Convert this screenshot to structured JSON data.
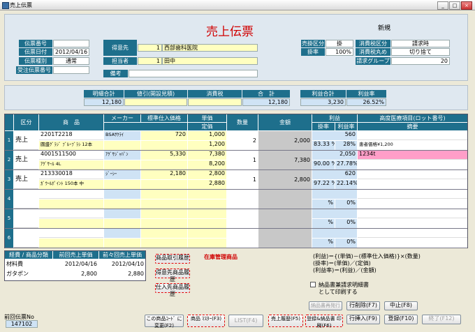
{
  "window": {
    "title": "売上伝票",
    "min": "_",
    "max": "□",
    "close": "×"
  },
  "header": {
    "title": "売上伝票",
    "mode": "新規"
  },
  "left": {
    "denpyo_no_label": "伝票番号",
    "denpyo_no": "",
    "date_label": "伝票日付",
    "date": "2012/04/16",
    "type_label": "伝票種別",
    "type": "通常",
    "order_label": "受注伝票番号",
    "order": ""
  },
  "customer": {
    "tokui_label": "得意先",
    "tokui_code": "1",
    "tokui_name": "西部歯科医院",
    "tanto_label": "担当者",
    "tanto_code": "1",
    "tanto_name": "田中",
    "biko_label": "備考",
    "biko": ""
  },
  "tax": {
    "kubun_label": "売掛区分",
    "kubun": "掛",
    "calc_label": "消費税区分",
    "calc": "請求時",
    "rate_label": "掛率",
    "rate": "100%",
    "round_label": "消費税丸め",
    "round": "切り捨て",
    "group_label": "請求グループ",
    "group": "20"
  },
  "totals": {
    "meisai_label": "明細合計",
    "meisai": "12,180",
    "nebiki_label": "値引(開設見積)",
    "nebiki": "",
    "shohizei_label": "消費税",
    "shohizei": "",
    "gokei_label": "合　計",
    "gokei": "12,180",
    "rieki_label": "利益合計",
    "rieki": "3,230",
    "riekiritsu_label": "利益率",
    "riekiritsu": "26.52%"
  },
  "grid": {
    "h_kubun": "区分",
    "h_shohin": "商　品",
    "h_maker": "メーカー",
    "h_hyojun": "標準仕入価格",
    "h_tanka": "単価",
    "h_teika": "定価",
    "h_suryo": "数量",
    "h_kingaku": "金額",
    "h_rieki": "利益",
    "h_kakeritsu": "掛率",
    "h_riekiritsu": "利益率",
    "h_kodo": "高度医療項目(ロット番号)",
    "h_tekiyo": "摘要",
    "rows": [
      {
        "no": "1",
        "kubun": "売上",
        "code": "2201T2218",
        "name": "圓盛ｸﾞﾗｼﾞ ﾌﾞﾙｰﾌﾞﾗｼ 12本",
        "maker": "BSAｻｸﾗｲ",
        "hyojun": "720",
        "tanka": "1,000",
        "teika": "1,200",
        "suryo": "2",
        "kingaku": "2,000",
        "rieki": "560",
        "kakeritsu": "83.33 %",
        "riekiritsu": "28%",
        "lot": "",
        "tekiyo": "患者価格¥1,200"
      },
      {
        "no": "2",
        "kubun": "売上",
        "code": "4001511500",
        "name": "ｱｸﾞｻｰﾙ 4L",
        "maker": "ｱｸﾞｻｼﾞｬﾊﾟﾝ",
        "hyojun": "5,330",
        "tanka": "7,380",
        "teika": "8,200",
        "suryo": "1",
        "kingaku": "7,380",
        "rieki": "2,050",
        "kakeritsu": "90.00 %",
        "riekiritsu": "27.78%",
        "lot": "1234t",
        "tekiyo": ""
      },
      {
        "no": "3",
        "kubun": "売上",
        "code": "213330018",
        "name": "ｶﾞｳｰﾙﾎﾟｲﾝﾄ 150本 中",
        "maker": "ｼﾞｰｼｰ",
        "hyojun": "2,180",
        "tanka": "2,800",
        "teika": "2,880",
        "suryo": "1",
        "kingaku": "2,800",
        "rieki": "620",
        "kakeritsu": "97.22 %",
        "riekiritsu": "22.14%",
        "lot": "",
        "tekiyo": ""
      },
      {
        "no": "4",
        "kubun": "",
        "code": "",
        "name": "",
        "maker": "",
        "hyojun": "",
        "tanka": "",
        "teika": "",
        "suryo": "",
        "kingaku": "",
        "rieki": "",
        "kakeritsu": "%",
        "riekiritsu": "0%",
        "lot": "",
        "tekiyo": ""
      },
      {
        "no": "5",
        "kubun": "",
        "code": "",
        "name": "",
        "maker": "",
        "hyojun": "",
        "tanka": "",
        "teika": "",
        "suryo": "",
        "kingaku": "",
        "rieki": "",
        "kakeritsu": "%",
        "riekiritsu": "0%",
        "lot": "",
        "tekiyo": ""
      },
      {
        "no": "6",
        "kubun": "",
        "code": "",
        "name": "",
        "maker": "",
        "hyojun": "",
        "tanka": "",
        "teika": "",
        "suryo": "",
        "kingaku": "",
        "rieki": "",
        "kakeritsu": "%",
        "riekiritsu": "0%",
        "lot": "",
        "tekiyo": ""
      }
    ]
  },
  "history": {
    "h_bunrui": "経費 / 商品分類",
    "h_prev": "前回売上単価",
    "h_prev2": "前々回売上単価",
    "rows": [
      {
        "bunrui": "材料費",
        "prev": "2012/04/16",
        "prev2": "2012/04/10"
      },
      {
        "bunrui": "ガタポン",
        "prev": "2,800",
        "prev2": "2,880"
      }
    ]
  },
  "midbuttons": {
    "b1": "商品取引履歴",
    "b2": "得意先商品履歴",
    "b3": "仕入先商品履歴"
  },
  "stock_label": "在庫管理商品",
  "formula": {
    "l1": "(利益)＝{(単価)－(標準仕入価格)}×(数量)",
    "l2": "(掛率)＝(単価)／(定価)",
    "l3": "(利益率)＝(利益)／(金額)"
  },
  "print_check": {
    "label1": "納品書兼請求明細書",
    "label2": "として印刷する"
  },
  "buttons": {
    "nohin": "納品書再発行",
    "row_delete": "行削除(F7)",
    "cancel": "中止(F8)",
    "row_insert": "行挿入(F9)",
    "register": "登録(F10)",
    "end": "終了(F12)",
    "code_change": "この商品ｺｰﾄﾞ に変更(F2)",
    "shohin_master": "商品 ﾏｽﾀｰ(F3)",
    "list": "LIST(F4)",
    "sales_history": "売上履歴(F5)",
    "register_print": "登録&納品書 印刷(F6)"
  },
  "prev_denpyo": {
    "label": "前回伝票No",
    "value": "147102"
  }
}
